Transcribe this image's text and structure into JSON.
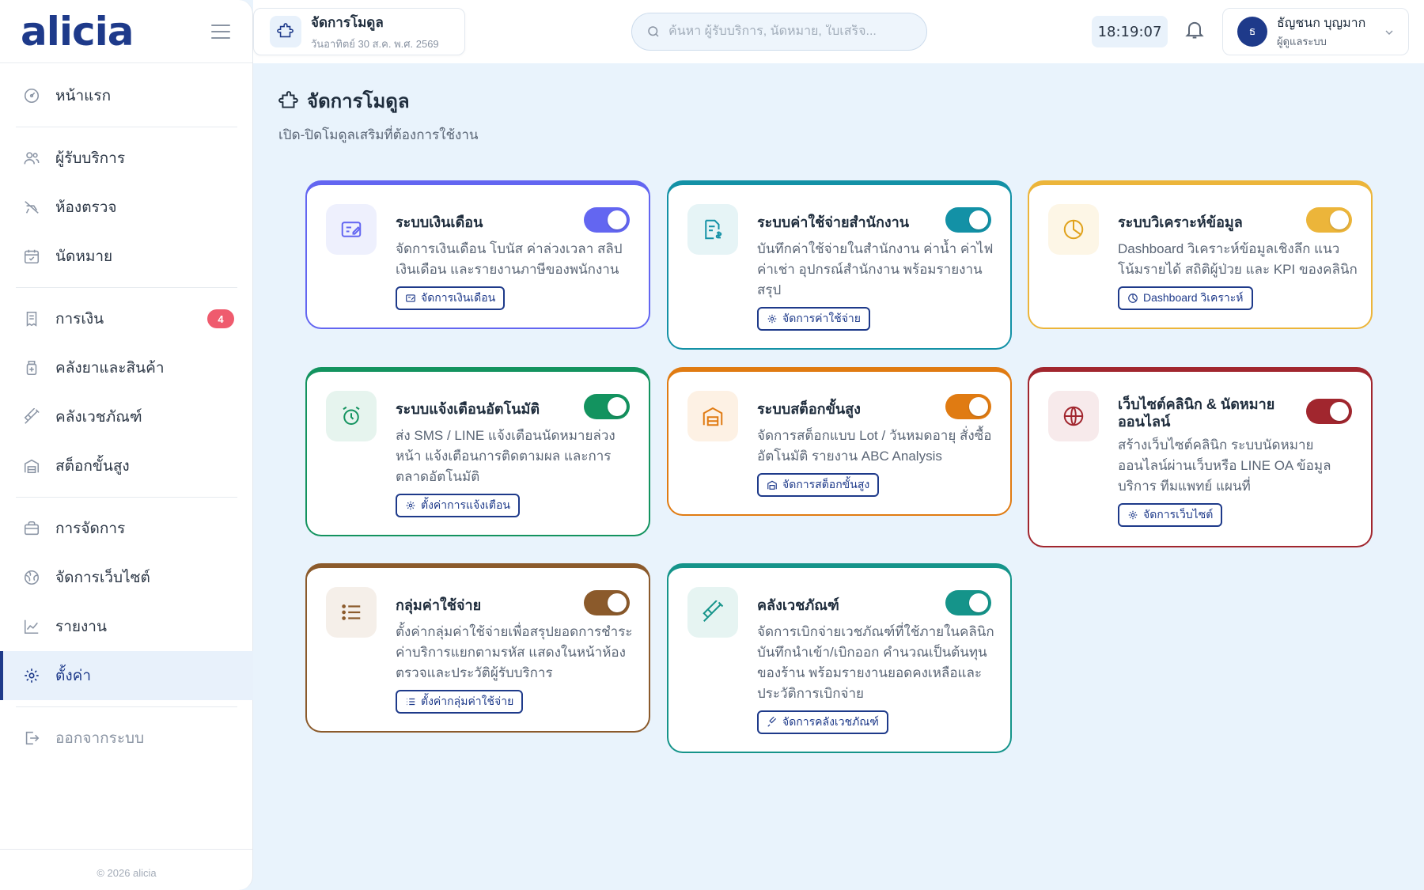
{
  "app": {
    "logo": "alicia"
  },
  "sidebar": {
    "items": [
      {
        "label": "หน้าแรก",
        "icon": "dashboard-icon"
      },
      {
        "label": "ผู้รับบริการ",
        "icon": "users-icon"
      },
      {
        "label": "ห้องตรวจ",
        "icon": "exam-room-icon"
      },
      {
        "label": "นัดหมาย",
        "icon": "calendar-icon"
      },
      {
        "label": "การเงิน",
        "icon": "receipt-icon",
        "badge": "4"
      },
      {
        "label": "คลังยาและสินค้า",
        "icon": "medicine-icon"
      },
      {
        "label": "คลังเวชภัณฑ์",
        "icon": "syringe-icon"
      },
      {
        "label": "สต็อกขั้นสูง",
        "icon": "warehouse-icon"
      },
      {
        "label": "การจัดการ",
        "icon": "briefcase-icon"
      },
      {
        "label": "จัดการเว็บไซต์",
        "icon": "globe-icon"
      },
      {
        "label": "รายงาน",
        "icon": "chart-icon"
      },
      {
        "label": "ตั้งค่า",
        "icon": "gear-icon"
      }
    ],
    "logout": "ออกจากระบบ",
    "copyright": "© 2026 alicia"
  },
  "header": {
    "module_title": "จัดการโมดูล",
    "module_date": "วันอาทิตย์ 30 ส.ค. พ.ศ. 2569",
    "search_placeholder": "ค้นหา ผู้รับบริการ, นัดหมาย, ใบเสร็จ...",
    "clock": "18:19:07",
    "user_initial": "ธ",
    "user_name": "ธัญชนก บุญมาก",
    "user_role": "ผู้ดูแลระบบ"
  },
  "page": {
    "title": "จัดการโมดูล",
    "subtitle": "เปิด-ปิดโมดูลเสริมที่ต้องการใช้งาน"
  },
  "modules": [
    {
      "title": "ระบบเงินเดือน",
      "desc": "จัดการเงินเดือน โบนัส ค่าล่วงเวลา สลิปเงินเดือน และรายงานภาษีของพนักงาน",
      "button": "จัดการเงินเดือน",
      "color": "#6366f1",
      "enabled": true
    },
    {
      "title": "ระบบค่าใช้จ่ายสำนักงาน",
      "desc": "บันทึกค่าใช้จ่ายในสำนักงาน ค่าน้ำ ค่าไฟ ค่าเช่า อุปกรณ์สำนักงาน พร้อมรายงานสรุป",
      "button": "จัดการค่าใช้จ่าย",
      "color": "#1391a6",
      "enabled": true
    },
    {
      "title": "ระบบวิเคราะห์ข้อมูล",
      "desc": "Dashboard วิเคราะห์ข้อมูลเชิงลึก แนวโน้มรายได้ สถิติผู้ป่วย และ KPI ของคลินิก",
      "button": "Dashboard วิเคราะห์",
      "color": "#ecb53a",
      "enabled": true
    },
    {
      "title": "ระบบแจ้งเตือนอัตโนมัติ",
      "desc": "ส่ง SMS / LINE แจ้งเตือนนัดหมายล่วงหน้า แจ้งเตือนการติดตามผล และการตลาดอัตโนมัติ",
      "button": "ตั้งค่าการแจ้งเตือน",
      "color": "#13935f",
      "enabled": true
    },
    {
      "title": "ระบบสต็อกขั้นสูง",
      "desc": "จัดการสต็อกแบบ Lot / วันหมดอายุ สั่งซื้ออัตโนมัติ รายงาน ABC Analysis",
      "button": "จัดการสต็อกขั้นสูง",
      "color": "#e07b12",
      "enabled": true
    },
    {
      "title": "เว็บไซต์คลินิก & นัดหมายออนไลน์",
      "desc": "สร้างเว็บไซต์คลินิก ระบบนัดหมายออนไลน์ผ่านเว็บหรือ LINE OA ข้อมูลบริการ ทีมแพทย์ แผนที่",
      "button": "จัดการเว็บไซต์",
      "color": "#a1262e",
      "enabled": true
    },
    {
      "title": "กลุ่มค่าใช้จ่าย",
      "desc": "ตั้งค่ากลุ่มค่าใช้จ่ายเพื่อสรุปยอดการชำระค่าบริการแยกตามรหัส แสดงในหน้าห้องตรวจและประวัติผู้รับบริการ",
      "button": "ตั้งค่ากลุ่มค่าใช้จ่าย",
      "color": "#8b5a2b",
      "enabled": true
    },
    {
      "title": "คลังเวชภัณฑ์",
      "desc": "จัดการเบิกจ่ายเวชภัณฑ์ที่ใช้ภายในคลินิก บันทึกนำเข้า/เบิกออก คำนวณเป็นต้นทุนของร้าน พร้อมรายงานยอดคงเหลือและประวัติการเบิกจ่าย",
      "button": "จัดการคลังเวชภัณฑ์",
      "color": "#15948a",
      "enabled": true
    }
  ]
}
